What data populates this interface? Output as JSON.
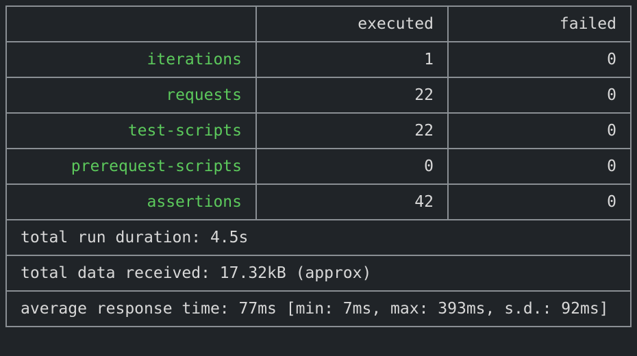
{
  "header": {
    "col_executed": "executed",
    "col_failed": "failed"
  },
  "rows": [
    {
      "label": "iterations",
      "executed": "1",
      "failed": "0"
    },
    {
      "label": "requests",
      "executed": "22",
      "failed": "0"
    },
    {
      "label": "test-scripts",
      "executed": "22",
      "failed": "0"
    },
    {
      "label": "prerequest-scripts",
      "executed": "0",
      "failed": "0"
    },
    {
      "label": "assertions",
      "executed": "42",
      "failed": "0"
    }
  ],
  "footer": {
    "duration": "total run duration: 4.5s",
    "data_received": "total data received: 17.32kB (approx)",
    "response_time": "average response time: 77ms [min: 7ms, max: 393ms, s.d.: 92ms]"
  },
  "colors": {
    "background": "#202428",
    "border": "#8a8f94",
    "label": "#5cc95c",
    "text": "#d8d8d8"
  }
}
